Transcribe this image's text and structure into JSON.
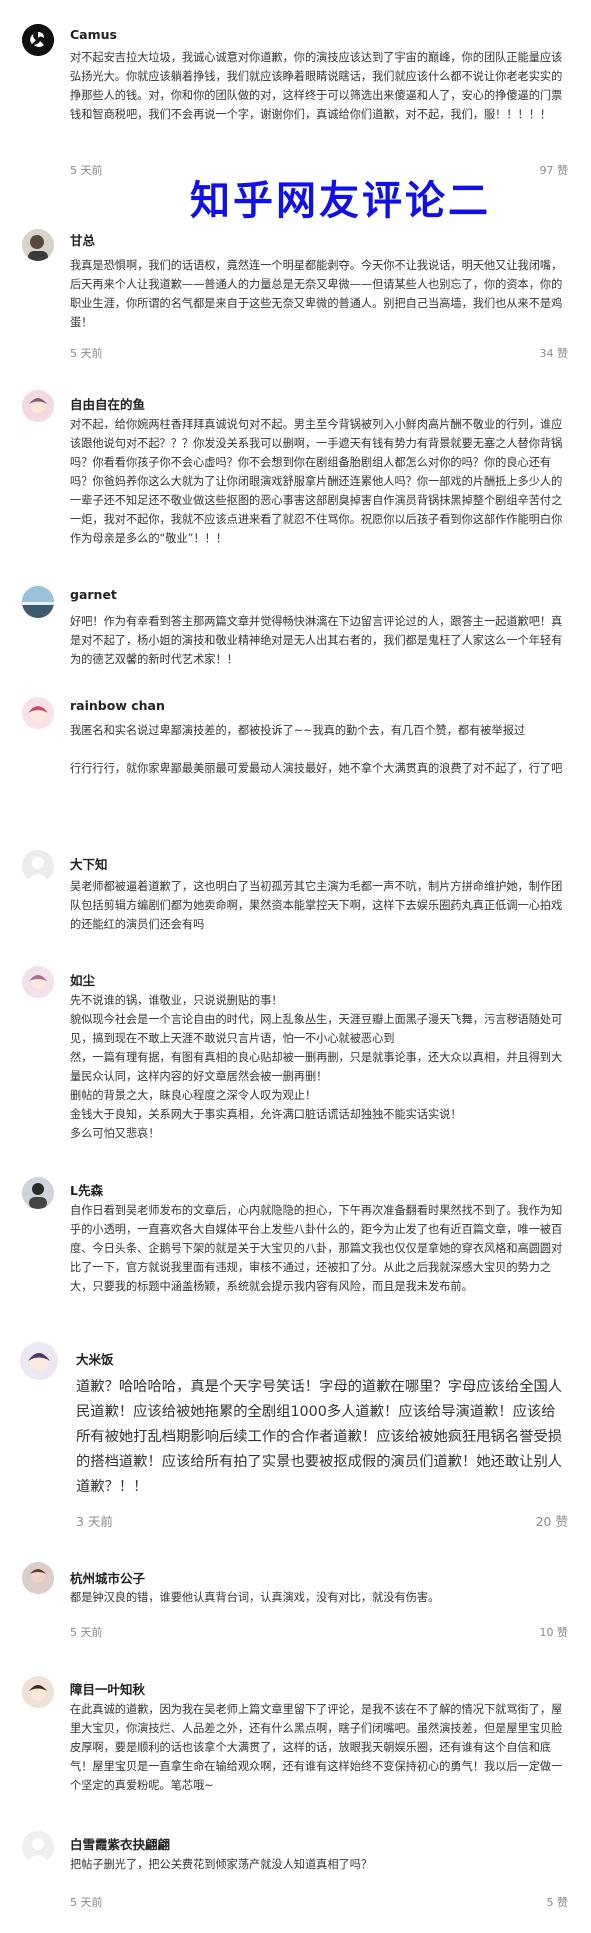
{
  "overlay_title": "知乎网友评论二",
  "comments": [
    {
      "user": "Camus",
      "text": [
        "对不起安吉拉大垃圾，我诚心诚意对你道歉，你的演技应该达到了宇宙的巅峰，你的团队正能量应该弘扬光大。你就应该躺着挣钱，我们就应该睁着眼睛说瞎话，我们就应该什么都不说让你老老实实的挣那些人的钱。对，你和你的团队做的对，这样终于可以筛选出来傻逼和人了，安心的挣傻逼的门票钱和智商税吧，我们不会再说一个字，谢谢你们，真诚给你们道歉，对不起，我们，服！！！！！"
      ],
      "time": "5 天前",
      "likes": "97 赞"
    },
    {
      "user": "甘总",
      "text": [
        "我真是恐惧啊，我们的话语权，竟然连一个明星都能剥夺。今天你不让我说话，明天他又让我闭嘴，后天再来个人让我道歉——普通人的力量总是无奈又卑微——但请某些人也别忘了，你的资本，你的职业生涯，你所谓的名气都是来自于这些无奈又卑微的普通人。别把自己当高墙，我们也从来不是鸡蛋！"
      ],
      "time": "5 天前",
      "likes": "34 赞"
    },
    {
      "user": "自由自在的鱼",
      "text": [
        "对不起，给你婉两柱香拜拜真诚说句对不起。男主至今背锅被列入小鲜肉高片酬不敬业的行列，谁应该跟他说句对不起？？？你发没关系我可以删啊，一手遮天有钱有势力有背景就要无塞之人替你背锅吗？你看看你孩子你不会心虚吗？你不会想到你在剧组备胎剧组人都怎么对你的吗？你的良心还有吗？你爸妈养你这么大就为了让你闭眼演戏舒服拿片酬还连累他人吗？你一部戏的片酬抵上多少人的一辈子还不知足还不敬业做这些抠图的恶心事害这部剧臭掉害自作演员背锅抹黑掉整个剧组辛苦付之一炬，我对不起你，我就不应该点进来看了就忍不住骂你。祝愿你以后孩子看到你这部作作能明白你作为母亲是多么的“敬业”！！！"
      ]
    },
    {
      "user": "garnet",
      "text": [
        "好吧！作为有幸看到答主那两篇文章并觉得畅快淋漓在下边留言评论过的人，跟答主一起道歉吧！真是对不起了，杨小姐的演技和敬业精神绝对是无人出其右者的，我们都是鬼枉了人家这么一个年轻有为的德艺双馨的新时代艺术家！！"
      ]
    },
    {
      "user": "rainbow chan",
      "text": [
        "我匿名和实名说过卑鄙演技差的，都被投诉了~~我真的勤个去，有几百个赞，都有被举报过",
        "",
        "行行行行，就你家卑鄙最美丽最可爱最动人演技最好，她不拿个大满贯真的浪费了对不起了，行了吧"
      ]
    },
    {
      "user": "大下知",
      "text": [
        "吴老师都被逼着道歉了，这也明白了当初孤芳其它主演为毛都一声不吭，制片方拼命维护她，制作团队包括剪辑方编剧们都为她卖命啊，果然资本能掌控天下啊，这样下去娱乐圈药丸真正低调一心拍戏的还能红的演员们还会有吗"
      ]
    },
    {
      "user": "如尘",
      "text": [
        "先不说谁的锅，谁敬业，只说说删贴的事！",
        "貌似现今社会是一个言论自由的时代，网上乱象丛生，天涯豆瓣上面黑子漫天飞舞，污言秽语随处可见，搞到现在不敢上天涯不敢说只言片语，怕一不小心就被恶心到",
        "然，一篇有理有据，有图有真相的良心贴却被一删再删，只是就事论事，还大众以真相，并且得到大量民众认同，这样内容的好文章居然会被一删再删！",
        "删帖的背景之大，眛良心程度之深令人叹为观止！",
        "金钱大于良知，关系网大于事实真相，允许满口脏话谎话却独独不能实话实说！",
        "多么可怕又悲哀！"
      ]
    },
    {
      "user": "L先森",
      "text": [
        "自作日看到吴老师发布的文章后，心内就隐隐的担心，下午再次准备翻看时果然找不到了。我作为知乎的小透明，一直喜欢各大自媒体平台上发些八卦什么的，距今为止发了也有近百篇文章，唯一被百度、今日头条、企鹅号下架的就是关于大宝贝的八卦，那篇文我也仅仅是拿她的穿衣风格和高圆圆对比了一下，官方就说我里面有违规，审核不通过，还被扣了分。从此之后我就深感大宝贝的势力之大，只要我的标题中涵盖杨颖，系统就会提示我内容有风险，而且是我未发布前。"
      ]
    },
    {
      "user": "大米饭",
      "text": [
        "道歉？哈哈哈哈，真是个天字号笑话！字母的道歉在哪里？字母应该给全国人民道歉！应该给被她拖累的全剧组1000多人道歉！应该给导演道歉！应该给所有被她打乱档期影响后续工作的合作者道歉！应该给被她疯狂甩锅名誉受损的搭档道歉！应该给所有拍了实景也要被抠成假的演员们道歉！她还敢让别人道歉？！！"
      ],
      "time": "3 天前",
      "likes": "20 赞"
    },
    {
      "user": "杭州城市公子",
      "text": [
        "都是钟汉良的错，谁要他认真背台词，认真演戏，没有对比，就没有伤害。"
      ],
      "time": "5 天前",
      "likes": "10 赞"
    },
    {
      "user": "障目一叶知秋",
      "text": [
        "在此真诚的道歉，因为我在吴老师上篇文章里留下了评论，是我不该在不了解的情况下就骂街了，屋里大宝贝，你演技烂、人品差之外，还有什么黑点啊，瞎子们闭嘴吧。虽然演技差，但是屋里宝贝脸皮厚啊，要是顺利的话也该拿个大满贯了，这样的话，放眼我天朝娱乐圈，还有谁有这个自信和底气！屋里宝贝是一直拿生命在输给观众啊，还有谁有这样始终不变保持初心的勇气！我以后一定做一个坚定的真爱粉呢。笔芯哦~"
      ]
    },
    {
      "user": "白雪霞紫衣抉翩翩",
      "text": [
        "把帖子删光了，把公关费花到倾家荡产就没人知道真相了吗？"
      ],
      "time": "5 天前",
      "likes": "5 赞"
    }
  ]
}
